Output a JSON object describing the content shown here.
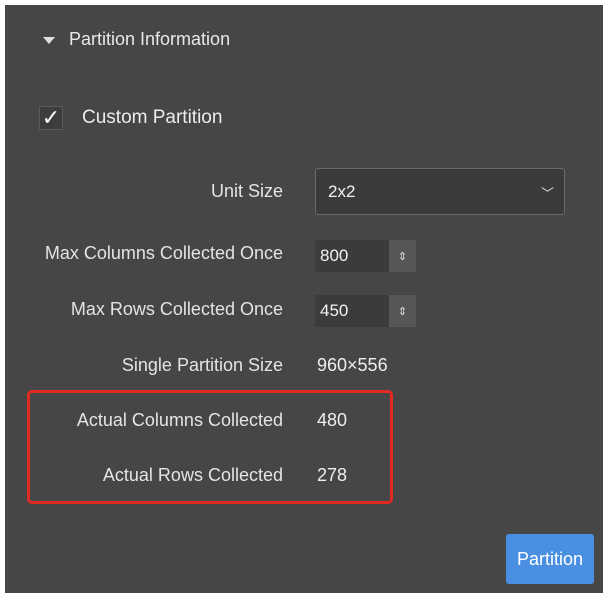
{
  "section": {
    "title": "Partition Information",
    "icon": "caret-down-icon"
  },
  "custom_partition": {
    "label": "Custom Partition",
    "checked": true,
    "check_glyph": "✓"
  },
  "unit_size": {
    "label": "Unit Size",
    "value": "2x2",
    "chevron": "﹀"
  },
  "max_columns": {
    "label": "Max Columns Collected Once",
    "value": "800",
    "arrows": "⇕"
  },
  "max_rows": {
    "label": "Max Rows Collected Once",
    "value": "450",
    "arrows": "⇕"
  },
  "single_partition_size": {
    "label": "Single Partition Size",
    "value": "960×556"
  },
  "actual_columns": {
    "label": "Actual Columns Collected",
    "value": "480"
  },
  "actual_rows": {
    "label": "Actual Rows Collected",
    "value": "278"
  },
  "partition_button": {
    "label": "Partition",
    "color": "#4a90e2"
  },
  "highlight_color": "#e22a22"
}
